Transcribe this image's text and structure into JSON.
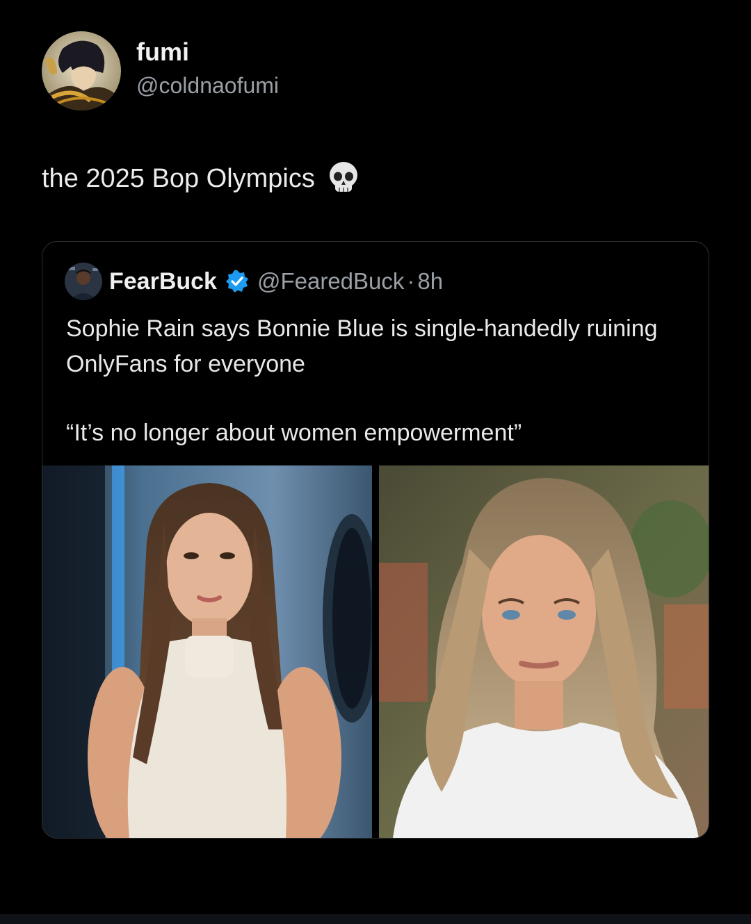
{
  "author": {
    "display_name": "fumi",
    "handle": "@coldnaofumi"
  },
  "tweet": {
    "text": "the 2025 Bop Olympics",
    "emoji": "skull-icon"
  },
  "quoted": {
    "display_name": "FearBuck",
    "verified": true,
    "handle": "@FearedBuck",
    "separator": "·",
    "time": "8h",
    "body": "Sophie Rain says Bonnie Blue is single-handedly ruining OnlyFans for everyone",
    "quote_line": "“It’s no longer about women empowerment”",
    "media": [
      {
        "name": "left-photo"
      },
      {
        "name": "right-photo"
      }
    ]
  },
  "colors": {
    "background": "#000000",
    "text": "#e7e9ea",
    "muted": "#9aa0a6",
    "border": "#2f3336",
    "verified": "#1d9bf0"
  }
}
